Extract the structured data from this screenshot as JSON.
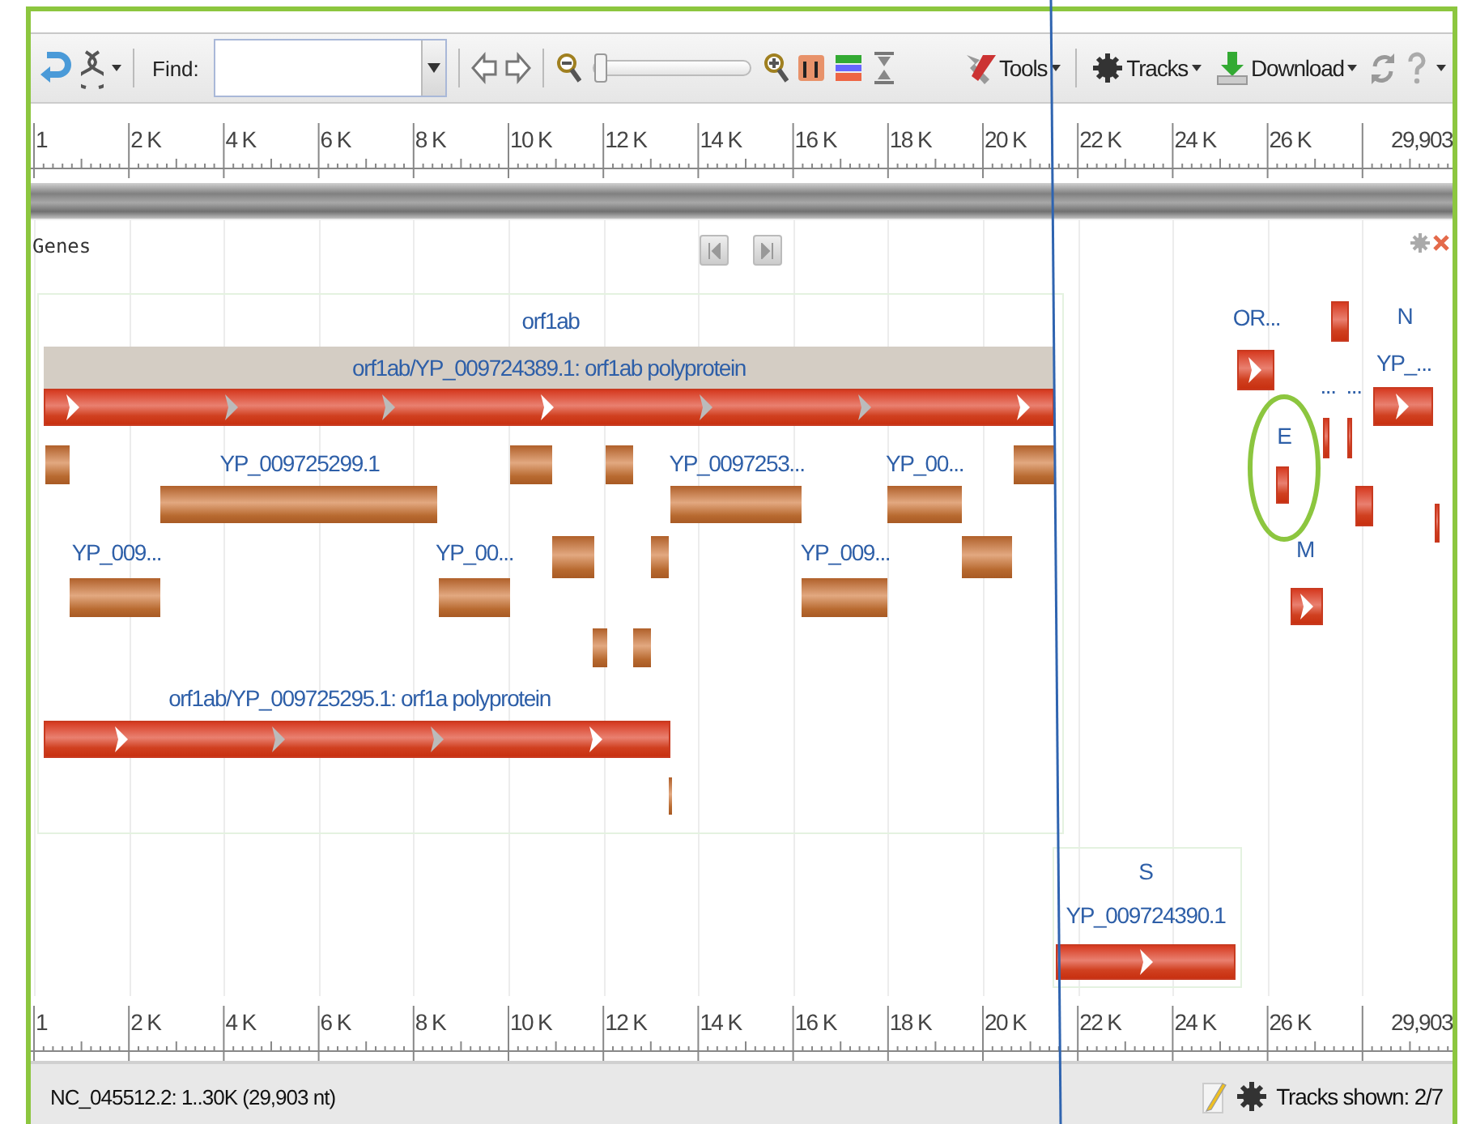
{
  "toolbar": {
    "find_label": "Find:",
    "slider": {
      "level": 0
    },
    "menus": [
      {
        "kind": "tools",
        "label": "Tools"
      },
      {
        "kind": "tracks",
        "label": "Tracks"
      },
      {
        "kind": "download",
        "label": "Download"
      }
    ]
  },
  "ruler_top": {
    "labels": [
      "1",
      "2 K",
      "4 K",
      "6 K",
      "8 K",
      "10 K",
      "12 K",
      "14 K",
      "16 K",
      "18 K",
      "20 K",
      "22 K",
      "24 K",
      "26 K",
      "29,903"
    ]
  },
  "track": {
    "title": "Genes",
    "features": [
      {
        "kind": "label",
        "text": "orf1ab"
      },
      {
        "kind": "band",
        "text": "orf1ab/YP_009724389.1: orf1ab polyprotein"
      },
      {
        "kind": "gene"
      },
      {
        "kind": "cds"
      },
      {
        "kind": "label",
        "text": "YP_009725299.1"
      },
      {
        "kind": "label",
        "text": "YP_0097253..."
      },
      {
        "kind": "label",
        "text": "YP_00..."
      },
      {
        "kind": "cds"
      },
      {
        "kind": "cds"
      },
      {
        "kind": "cds"
      },
      {
        "kind": "cds"
      },
      {
        "kind": "cds"
      },
      {
        "kind": "cds"
      },
      {
        "kind": "label",
        "text": "YP_009..."
      },
      {
        "kind": "label",
        "text": "YP_00..."
      },
      {
        "kind": "label",
        "text": "YP_009..."
      },
      {
        "kind": "cds"
      },
      {
        "kind": "cds"
      },
      {
        "kind": "cds"
      },
      {
        "kind": "cds"
      },
      {
        "kind": "cds"
      },
      {
        "kind": "cds"
      },
      {
        "kind": "cds"
      },
      {
        "kind": "cds"
      },
      {
        "kind": "label",
        "text": "orf1ab/YP_009725295.1: orf1a polyprotein"
      },
      {
        "kind": "gene"
      },
      {
        "kind": "cds"
      },
      {
        "kind": "label",
        "text": "S"
      },
      {
        "kind": "label",
        "text": "YP_009724390.1"
      },
      {
        "kind": "gene"
      },
      {
        "kind": "label",
        "text": "OR..."
      },
      {
        "kind": "gene"
      },
      {
        "kind": "gene"
      },
      {
        "kind": "label",
        "text": "N"
      },
      {
        "kind": "label",
        "text": "YP_..."
      },
      {
        "kind": "gene"
      },
      {
        "kind": "label",
        "text": "..."
      },
      {
        "kind": "label",
        "text": "..."
      },
      {
        "kind": "gene"
      },
      {
        "kind": "gene"
      },
      {
        "kind": "label",
        "text": "E"
      },
      {
        "kind": "gene"
      },
      {
        "kind": "gene"
      },
      {
        "kind": "gene"
      },
      {
        "kind": "label",
        "text": "M"
      },
      {
        "kind": "gene"
      }
    ]
  },
  "ruler_bottom": {
    "labels": [
      "1",
      "2 K",
      "4 K",
      "6 K",
      "8 K",
      "10 K",
      "12 K",
      "14 K",
      "16 K",
      "18 K",
      "20 K",
      "22 K",
      "24 K",
      "26 K",
      "29,903"
    ]
  },
  "status_bar": {
    "location": "NC_045512.2: 1..30K (29,903 nt)",
    "tracks_shown": "Tracks shown: 2/7"
  }
}
